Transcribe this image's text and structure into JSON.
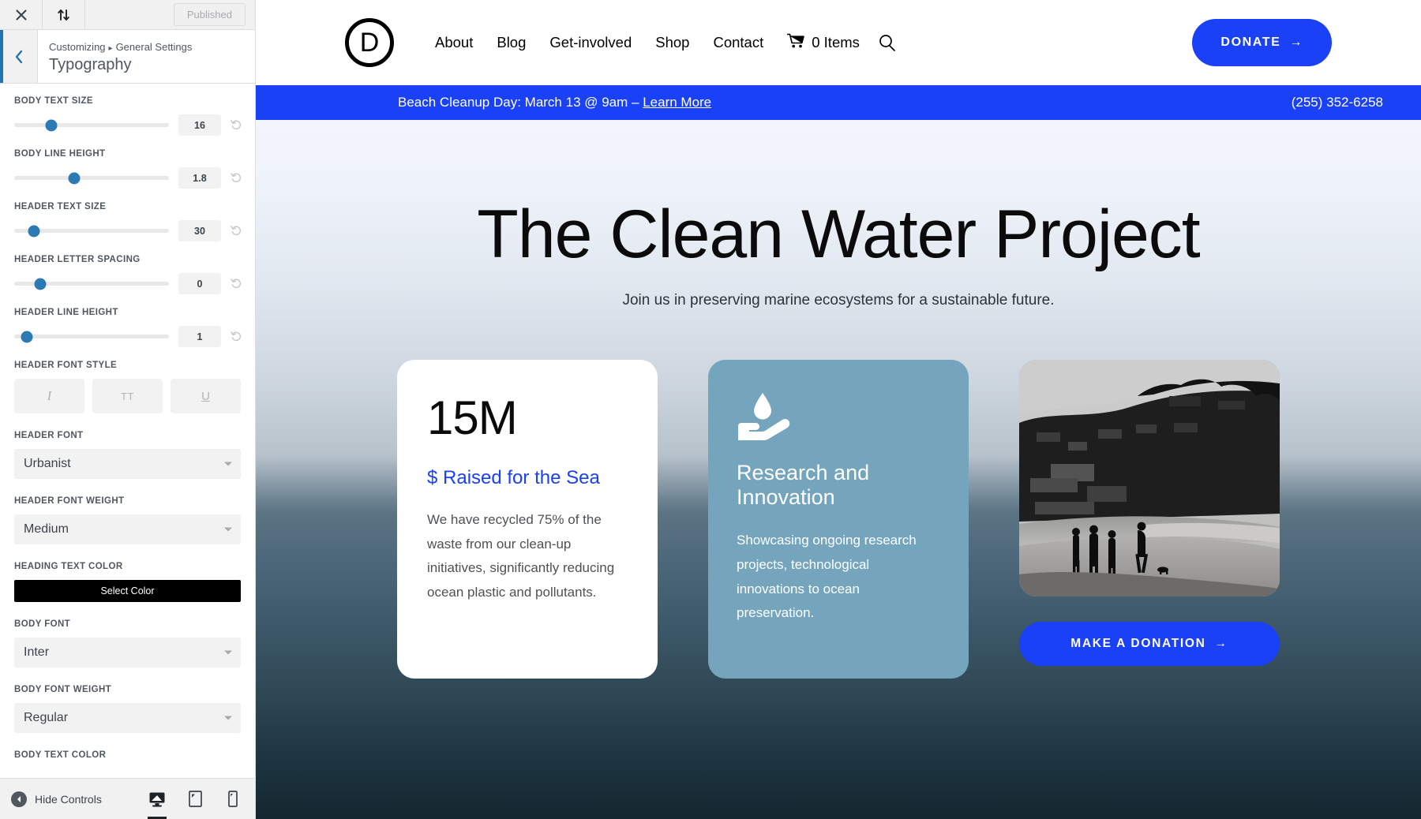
{
  "customizer": {
    "topbar": {
      "close_icon": "close-icon",
      "collapse_icon": "sort-updown-icon",
      "published_label": "Published"
    },
    "breadcrumb_root": "Customizing",
    "breadcrumb_sep": "▸",
    "breadcrumb_parent": "General Settings",
    "panel_title": "Typography",
    "controls": [
      {
        "label": "BODY TEXT SIZE",
        "value": "16",
        "thumb_pct": 24
      },
      {
        "label": "BODY LINE HEIGHT",
        "value": "1.8",
        "thumb_pct": 39
      },
      {
        "label": "HEADER TEXT SIZE",
        "value": "30",
        "thumb_pct": 13
      },
      {
        "label": "HEADER LETTER SPACING",
        "value": "0",
        "thumb_pct": 17
      },
      {
        "label": "HEADER LINE HEIGHT",
        "value": "1",
        "thumb_pct": 8
      }
    ],
    "font_style": {
      "label": "HEADER FONT STYLE",
      "buttons": [
        {
          "name": "italic-button",
          "glyph": "I"
        },
        {
          "name": "uppercase-button",
          "glyph": "TT"
        },
        {
          "name": "underline-button",
          "glyph": "U"
        }
      ]
    },
    "header_font": {
      "label": "HEADER FONT",
      "value": "Urbanist"
    },
    "header_font_weight": {
      "label": "HEADER FONT WEIGHT",
      "value": "Medium"
    },
    "heading_text_color": {
      "label": "HEADING TEXT COLOR",
      "button": "Select Color",
      "color": "#000000"
    },
    "body_font": {
      "label": "BODY FONT",
      "value": "Inter"
    },
    "body_font_weight": {
      "label": "BODY FONT WEIGHT",
      "value": "Regular"
    },
    "body_text_color": {
      "label": "BODY TEXT COLOR"
    },
    "footer": {
      "hide_controls": "Hide Controls",
      "devices": [
        {
          "name": "desktop-preview-button",
          "active": true
        },
        {
          "name": "tablet-preview-button",
          "active": false
        },
        {
          "name": "mobile-preview-button",
          "active": false
        }
      ]
    }
  },
  "site": {
    "logo_letter": "D",
    "nav": [
      {
        "label": "About"
      },
      {
        "label": "Blog"
      },
      {
        "label": "Get-involved"
      },
      {
        "label": "Shop"
      },
      {
        "label": "Contact"
      }
    ],
    "cart_label": "0 Items",
    "donate_button": "DONATE",
    "donate_arrow": "→",
    "announcement": {
      "text": "Beach Cleanup Day: March 13 @ 9am – ",
      "link": "Learn More",
      "phone": "(255) 352-6258"
    },
    "hero": {
      "title": "The Clean Water Project",
      "subtitle": "Join us in preserving marine ecosystems for a sustainable future."
    },
    "cards": {
      "stat": {
        "number": "15M",
        "label": "$ Raised for the Sea",
        "description": "We have recycled 75% of the waste from our clean-up initiatives, significantly reducing ocean plastic and pollutants."
      },
      "feature": {
        "icon": "water-drop-hand-icon",
        "title": "Research and Innovation",
        "description": "Showcasing ongoing research projects, technological innovations to ocean preservation."
      },
      "photo": {
        "alt": "beach-coastline-photo",
        "button": "MAKE A DONATION",
        "button_arrow": "→"
      }
    },
    "colors": {
      "brand_blue": "#1a41f5",
      "card_teal": "#74a5bd",
      "text_dark": "#0b0b0b"
    }
  }
}
